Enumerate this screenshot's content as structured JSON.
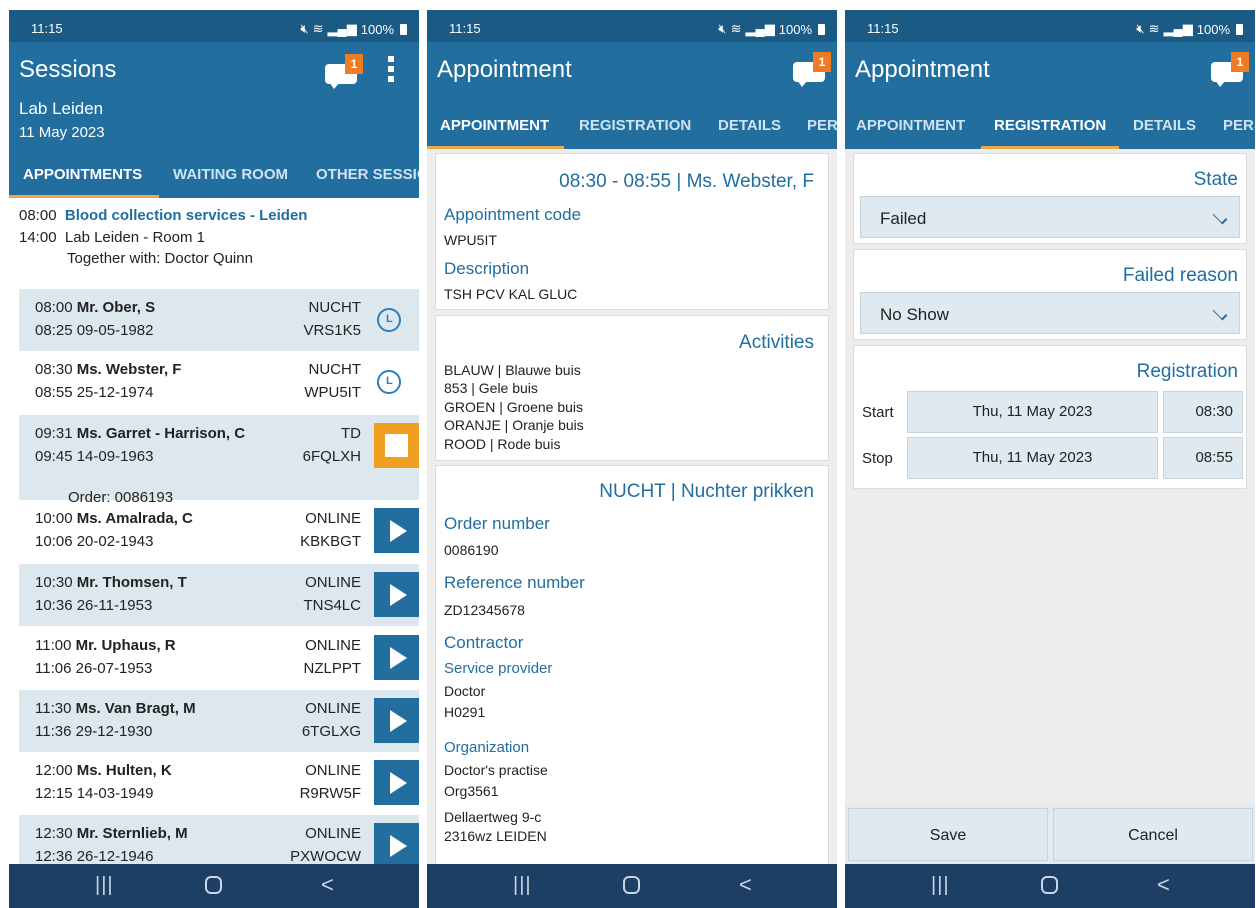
{
  "status": {
    "time": "11:15",
    "battery": "100%"
  },
  "badge_count": "1",
  "p1": {
    "title": "Sessions",
    "location": "Lab Leiden",
    "date": "11 May 2023",
    "tabs": [
      "APPOINTMENTS",
      "WAITING ROOM",
      "OTHER SESSIONS"
    ],
    "session": {
      "start": "08:00",
      "title": "Blood collection services - Leiden",
      "end": "14:00",
      "room": "Lab Leiden - Room 1",
      "together": "Together with: Doctor Quinn"
    },
    "rows": [
      {
        "time1": "08:00",
        "name": "Mr. Ober, S",
        "time2": "08:25",
        "dob": "09-05-1982",
        "type": "NUCHT",
        "code": "VRS1K5",
        "action": "clock"
      },
      {
        "time1": "08:30",
        "name": "Ms. Webster, F",
        "time2": "08:55",
        "dob": "25-12-1974",
        "type": "NUCHT",
        "code": "WPU5IT",
        "action": "clock"
      },
      {
        "time1": "09:31",
        "name": "Ms. Garret - Harrison, C",
        "time2": "09:45",
        "dob": "14-09-1963",
        "type": "TD",
        "code": "6FQLXH",
        "action": "stop",
        "order": "Order: 0086193"
      },
      {
        "time1": "10:00",
        "name": "Ms. Amalrada, C",
        "time2": "10:06",
        "dob": "20-02-1943",
        "type": "ONLINE",
        "code": "KBKBGT",
        "action": "play"
      },
      {
        "time1": "10:30",
        "name": "Mr. Thomsen, T",
        "time2": "10:36",
        "dob": "26-11-1953",
        "type": "ONLINE",
        "code": "TNS4LC",
        "action": "play"
      },
      {
        "time1": "11:00",
        "name": "Mr. Uphaus, R",
        "time2": "11:06",
        "dob": "26-07-1953",
        "type": "ONLINE",
        "code": "NZLPPT",
        "action": "play"
      },
      {
        "time1": "11:30",
        "name": "Ms. Van Bragt, M",
        "time2": "11:36",
        "dob": "29-12-1930",
        "type": "ONLINE",
        "code": "6TGLXG",
        "action": "play"
      },
      {
        "time1": "12:00",
        "name": "Ms. Hulten, K",
        "time2": "12:15",
        "dob": "14-03-1949",
        "type": "ONLINE",
        "code": "R9RW5F",
        "action": "play"
      },
      {
        "time1": "12:30",
        "name": "Mr. Sternlieb, M",
        "time2": "12:36",
        "dob": "26-12-1946",
        "type": "ONLINE",
        "code": "PXWOCW",
        "action": "play"
      }
    ]
  },
  "p2": {
    "title": "Appointment",
    "tabs": [
      "APPOINTMENT",
      "REGISTRATION",
      "DETAILS",
      "PERSON"
    ],
    "header": "08:30 - 08:55 | Ms. Webster, F",
    "code_label": "Appointment code",
    "code_value": "WPU5IT",
    "desc_label": "Description",
    "desc_value": "TSH PCV KAL GLUC",
    "activities_label": "Activities",
    "activities": [
      "BLAUW | Blauwe buis",
      "853 | Gele buis",
      "GROEN | Groene buis",
      "ORANJE | Oranje buis",
      "ROOD | Rode buis"
    ],
    "order_header": "NUCHT | Nuchter prikken",
    "order_label": "Order number",
    "order_value": "0086190",
    "ref_label": "Reference number",
    "ref_value": "ZD12345678",
    "contractor_label": "Contractor",
    "sp_label": "Service provider",
    "sp_line1": "Doctor",
    "sp_line2": "H0291",
    "org_label": "Organization",
    "org_line1": "Doctor's practise",
    "org_line2": "Org3561",
    "org_line3": "Dellaertweg 9-c",
    "org_line4": "2316wz LEIDEN"
  },
  "p3": {
    "title": "Appointment",
    "tabs": [
      "APPOINTMENT",
      "REGISTRATION",
      "DETAILS",
      "PERSON"
    ],
    "state_label": "State",
    "state_value": "Failed",
    "reason_label": "Failed reason",
    "reason_value": "No Show",
    "reg_label": "Registration",
    "start_label": "Start",
    "start_date": "Thu, 11 May 2023",
    "start_time": "08:30",
    "stop_label": "Stop",
    "stop_date": "Thu, 11 May 2023",
    "stop_time": "08:55",
    "save_label": "Save",
    "cancel_label": "Cancel"
  },
  "nav": {
    "recent": "|||",
    "home": "",
    "back": "<"
  },
  "colors": {
    "primary": "#216e9f",
    "statusbar": "#1a5a85",
    "accent": "#f0a64a",
    "badge": "#f07b25",
    "stop": "#f0a020",
    "nav": "#1d3f64"
  }
}
